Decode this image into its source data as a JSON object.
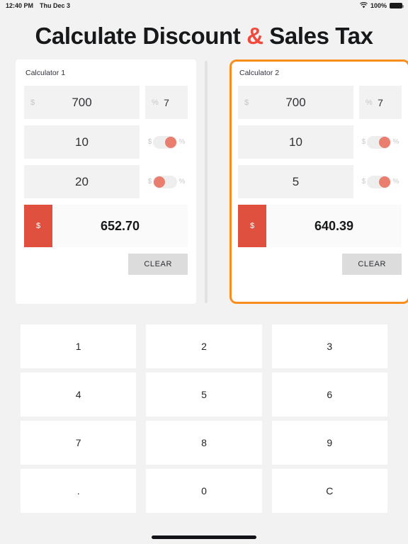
{
  "statusbar": {
    "time": "12:40 PM",
    "date": "Thu Dec 3",
    "wifi_icon": "wifi-icon",
    "battery_percent": "100%",
    "battery_icon": "battery-icon"
  },
  "header": {
    "title_part1": "Calculate Discount ",
    "title_amp": "&",
    "title_part2": " Sales Tax",
    "accent_color": "#f2493d"
  },
  "calculators": [
    {
      "name": "Calculator 1",
      "selected": false,
      "amount": {
        "prefix": "$",
        "value": "700"
      },
      "percent": {
        "prefix": "%",
        "value": "7"
      },
      "row2": {
        "value": "10",
        "toggle_left_label": "$",
        "toggle_right_label": "%",
        "toggle_on": true
      },
      "row3": {
        "value": "20",
        "toggle_left_label": "$",
        "toggle_right_label": "%",
        "toggle_on": false
      },
      "result": {
        "currency": "$",
        "value": "652.70"
      },
      "clear_label": "CLEAR"
    },
    {
      "name": "Calculator 2",
      "selected": true,
      "amount": {
        "prefix": "$",
        "value": "700"
      },
      "percent": {
        "prefix": "%",
        "value": "7"
      },
      "row2": {
        "value": "10",
        "toggle_left_label": "$",
        "toggle_right_label": "%",
        "toggle_on": true
      },
      "row3": {
        "value": "5",
        "toggle_left_label": "$",
        "toggle_right_label": "%",
        "toggle_on": true
      },
      "result": {
        "currency": "$",
        "value": "640.39"
      },
      "clear_label": "CLEAR"
    }
  ],
  "keypad": {
    "keys": [
      "1",
      "2",
      "3",
      "4",
      "5",
      "6",
      "7",
      "8",
      "9",
      ".",
      "0",
      "C"
    ]
  },
  "colors": {
    "page_background": "#f2f2f2",
    "card_background": "#ffffff",
    "selected_border": "#f78e1e",
    "currency_box": "#e0503f",
    "toggle_knob": "#e97d6e",
    "clear_button": "#dcdcdc"
  }
}
